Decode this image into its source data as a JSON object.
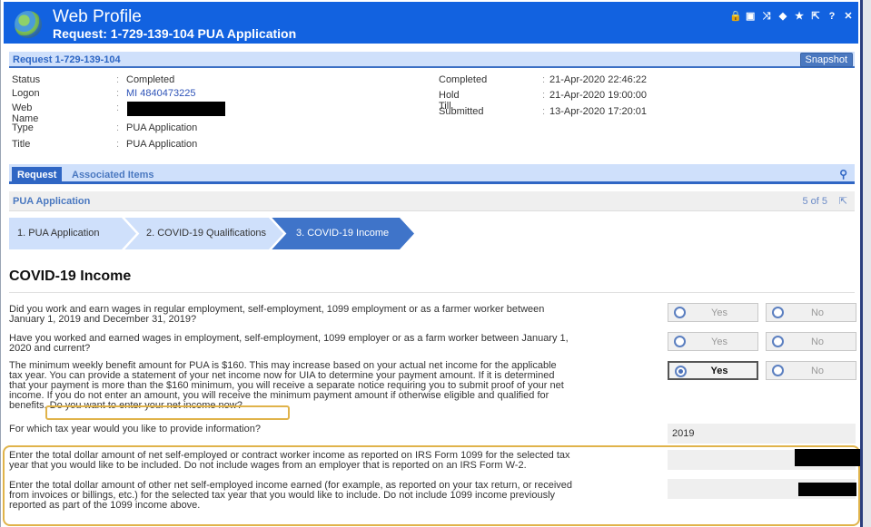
{
  "header": {
    "app_title": "Web Profile",
    "request_title": "Request: 1-729-139-104 PUA Application",
    "icons": [
      "lock-icon",
      "image-icon",
      "shuffle-icon",
      "tag-icon",
      "star-icon",
      "external-link-icon",
      "help-icon",
      "close-icon"
    ],
    "icon_glyphs": [
      "🔒",
      "▣",
      "⤨",
      "◆",
      "★",
      "⇱",
      "?",
      "✕"
    ]
  },
  "request_panel": {
    "label": "Request 1-729-139-104",
    "snapshot_label": "Snapshot",
    "left_fields": [
      {
        "label": "Status",
        "value": "Completed"
      },
      {
        "label": "Logon",
        "value": "MI 4840473225"
      },
      {
        "label": "Web Name",
        "value": ""
      },
      {
        "label": "Type",
        "value": "PUA Application"
      },
      {
        "label": "Title",
        "value": "PUA Application"
      }
    ],
    "right_fields": [
      {
        "label": "Completed",
        "value": "21-Apr-2020 22:46:22"
      },
      {
        "label": "Hold Till",
        "value": "21-Apr-2020 19:00:00"
      },
      {
        "label": "Submitted",
        "value": "13-Apr-2020 17:20:01"
      }
    ],
    "colon": ":"
  },
  "tabs": [
    {
      "label": "Request",
      "active": true
    },
    {
      "label": "Associated Items",
      "active": false
    }
  ],
  "section": {
    "title": "PUA Application",
    "count": "5 of 5"
  },
  "steps": [
    {
      "label": "1. PUA Application",
      "state": "done"
    },
    {
      "label": "2. COVID-19 Qualifications",
      "state": "done"
    },
    {
      "label": "3. COVID-19 Income",
      "state": "current"
    }
  ],
  "page": {
    "heading": "COVID-19 Income",
    "questions": [
      {
        "lines": [
          "Did you work and earn wages in regular employment, self-employment, 1099 employment or as a farmer worker between",
          "January 1, 2019 and December 31, 2019?"
        ],
        "yes_label": "Yes",
        "no_label": "No",
        "selected": "none"
      },
      {
        "lines": [
          "Have you worked and earned wages in employment, self-employment, 1099 employer or as a farm worker between January 1,",
          "2020 and current?"
        ],
        "yes_label": "Yes",
        "no_label": "No",
        "selected": "none"
      },
      {
        "lines": [
          "The minimum weekly benefit amount for PUA is $160. This may increase based on your actual net income for the applicable",
          "tax year. You can provide a statement of your net income now for UIA to determine your payment amount. If it is determined",
          "that your payment is more than the $160 minimum, you will receive a separate notice requiring you to submit proof of your net",
          "income. If you do not enter an amount, you will receive the minimum payment amount if otherwise eligible and qualified for"
        ],
        "last_line_prefix": "benefits.",
        "highlighted": "Do you want to enter your net income now?",
        "yes_label": "Yes",
        "no_label": "No",
        "selected": "yes"
      }
    ],
    "tax_year": {
      "question": "For which tax year would you like to provide information?",
      "value": "2019"
    },
    "income_1099": {
      "lines": [
        "Enter the total dollar amount of net self-employed or contract worker income as reported on IRS Form 1099 for the selected tax",
        "year that you would like to be included. Do not include wages from an employer that is reported on an IRS Form W-2."
      ],
      "value": ""
    },
    "income_other": {
      "lines": [
        "Enter the total dollar amount of other net self-employed income earned (for example, as reported on your tax return, or received",
        "from invoices or billings, etc.) for the selected tax year that you would like to include. Do not include 1099 income previously",
        "reported as part of the 1099 income above."
      ],
      "value": ""
    }
  },
  "colors": {
    "header_blue": "#1262e0",
    "accent_blue": "#2f66c4",
    "light_blue": "#cfe0fb",
    "highlight_gold": "#e0b34a"
  }
}
